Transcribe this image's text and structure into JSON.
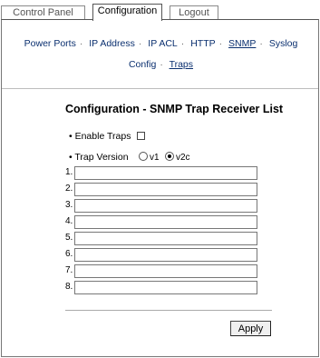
{
  "tabs": [
    {
      "label": "Control Panel"
    },
    {
      "label": "Configuration"
    },
    {
      "label": "Logout"
    }
  ],
  "nav_primary": [
    "Power Ports",
    "IP Address",
    "IP ACL",
    "HTTP",
    "SNMP",
    "Syslog"
  ],
  "nav_secondary": [
    "Config",
    "Traps"
  ],
  "nav_sep": "·",
  "page": {
    "title": "Configuration - SNMP Trap Receiver List",
    "enable_traps_label": "• Enable Traps",
    "trap_version_label": "• Trap Version",
    "v1_label": "v1",
    "v2c_label": "v2c",
    "apply_label": "Apply"
  },
  "receivers": [
    {
      "num": "1.",
      "value": ""
    },
    {
      "num": "2.",
      "value": ""
    },
    {
      "num": "3.",
      "value": ""
    },
    {
      "num": "4.",
      "value": ""
    },
    {
      "num": "5.",
      "value": ""
    },
    {
      "num": "6.",
      "value": ""
    },
    {
      "num": "7.",
      "value": ""
    },
    {
      "num": "8.",
      "value": ""
    }
  ]
}
